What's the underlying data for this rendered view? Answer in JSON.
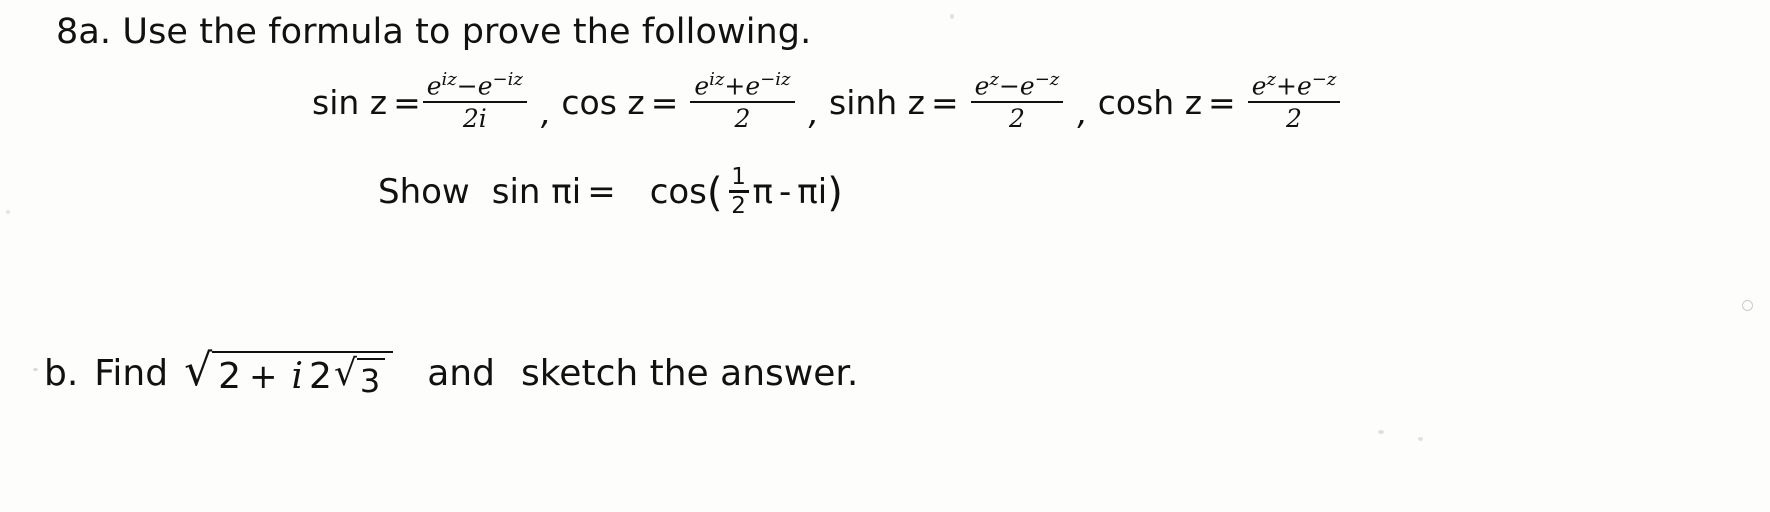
{
  "document": {
    "problem_a": {
      "label": "8a.",
      "instruction": "Use the formula to prove the following.",
      "full_text": "8a. Use the formula to prove the following."
    },
    "formulas": [
      {
        "name": "sin z",
        "equals": "=",
        "numerator": "e iz − e −iz",
        "numerator_base1": "e",
        "numerator_exp1": "iz",
        "numerator_op": "−",
        "numerator_base2": "e",
        "numerator_exp2": "−iz",
        "denominator": "2i",
        "separator": ","
      },
      {
        "name": "cos z",
        "equals": "=",
        "numerator": "e iz + e −iz",
        "numerator_base1": "e",
        "numerator_exp1": "iz",
        "numerator_op": "+",
        "numerator_base2": "e",
        "numerator_exp2": "−iz",
        "denominator": "2",
        "separator": ","
      },
      {
        "name": "sinh z",
        "equals": "=",
        "numerator": "e z − e −z",
        "numerator_base1": "e",
        "numerator_exp1": "z",
        "numerator_op": "−",
        "numerator_base2": "e",
        "numerator_exp2": "−z",
        "denominator": "2",
        "separator": ","
      },
      {
        "name": "cosh z",
        "equals": "=",
        "numerator": "e z + e −z",
        "numerator_base1": "e",
        "numerator_exp1": "z",
        "numerator_op": "+",
        "numerator_base2": "e",
        "numerator_exp2": "−z",
        "denominator": "2",
        "separator": ""
      }
    ],
    "show_line": {
      "keyword": "Show",
      "left_expr": "sin πi",
      "equals": "=",
      "cos_name": "cos",
      "open_paren": "(",
      "fraction_numerator": "1",
      "fraction_denominator": "2",
      "pi_first": "π",
      "minus": "-",
      "pi_i": "πi",
      "close_paren": ")",
      "full_text": "Show sin πi = cos ( 1/2 π - πi )"
    },
    "problem_b": {
      "label": "b.",
      "verb": "Find",
      "radical_sign": "√",
      "radicand_first": "2",
      "radicand_plus": "+",
      "radicand_i": "i",
      "radicand_coeff": "2",
      "inner_radical_sign": "√",
      "inner_radicand": "3",
      "conjunction": "and",
      "tail": "sketch the answer.",
      "full_text": "b. Find √(2 + i 2√3) and sketch the answer."
    }
  },
  "colors": {
    "ink": "#111111",
    "paper": "#fdfdfb"
  }
}
